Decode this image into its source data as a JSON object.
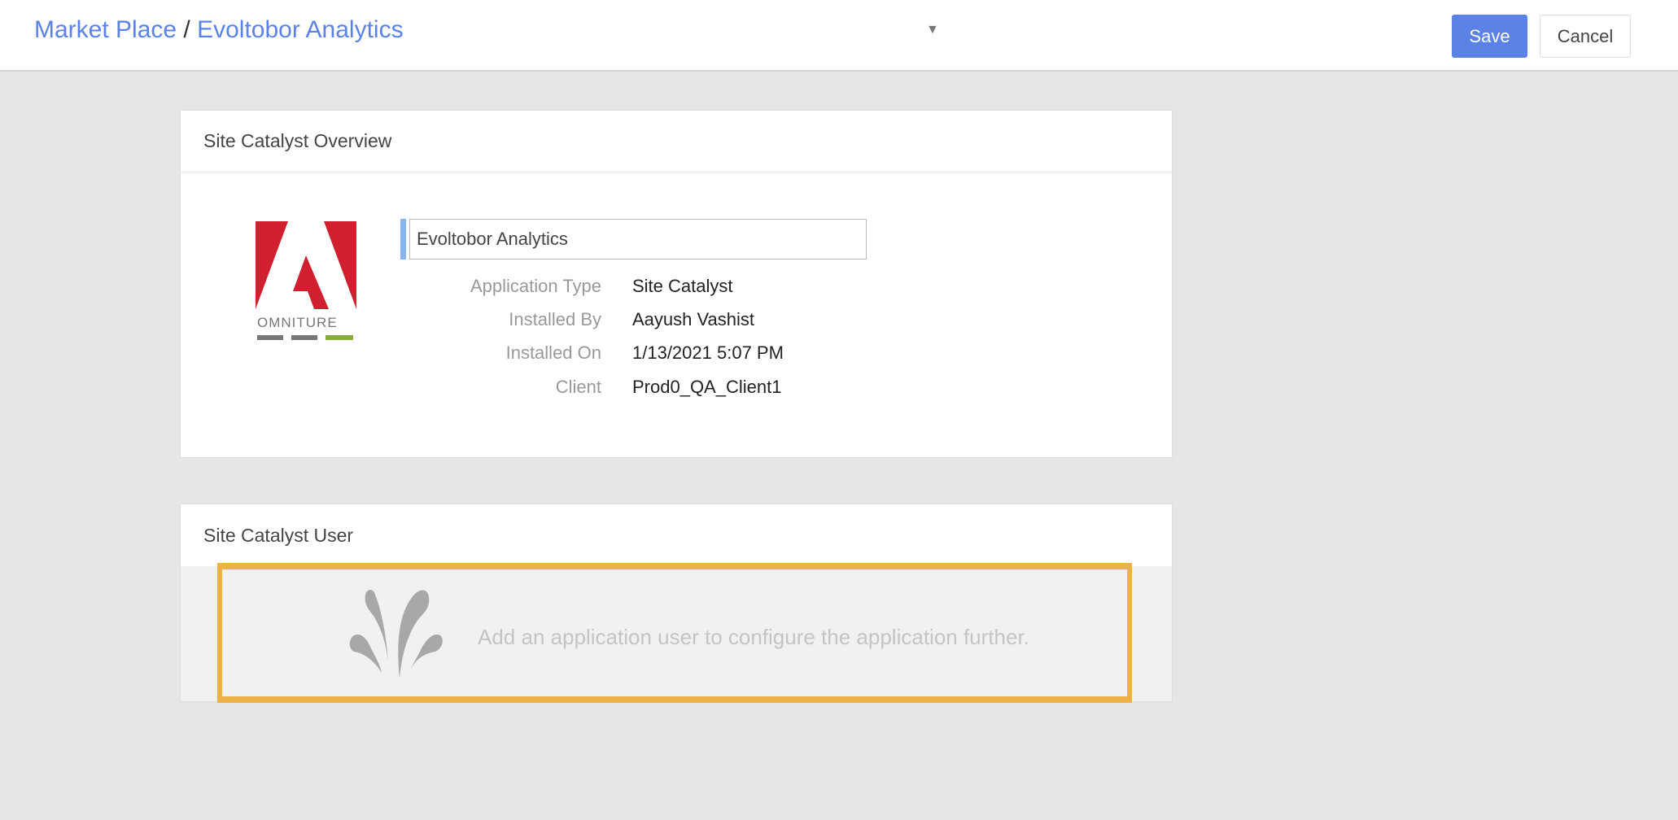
{
  "header": {
    "breadcrumb": [
      {
        "label": "Market Place"
      },
      {
        "label": "Evoltobor Analytics"
      }
    ],
    "separator": "/",
    "dropdown_icon": "caret-down-icon",
    "save_label": "Save",
    "cancel_label": "Cancel",
    "accent_color": "#5b82e6"
  },
  "overview": {
    "title": "Site Catalyst Overview",
    "logo_text": "OMNITURE",
    "name_value": "Evoltobor Analytics",
    "details": [
      {
        "label": "Application Type",
        "value": "Site Catalyst"
      },
      {
        "label": "Installed By",
        "value": "Aayush Vashist"
      },
      {
        "label": "Installed On",
        "value": "1/13/2021 5:07 PM"
      },
      {
        "label": "Client",
        "value": "Prod0_QA_Client1"
      }
    ]
  },
  "user_section": {
    "title": "Site Catalyst User",
    "empty_icon": "fountain-icon",
    "empty_message": "Add an application user to configure the application further.",
    "highlight_color": "#ecb247"
  }
}
